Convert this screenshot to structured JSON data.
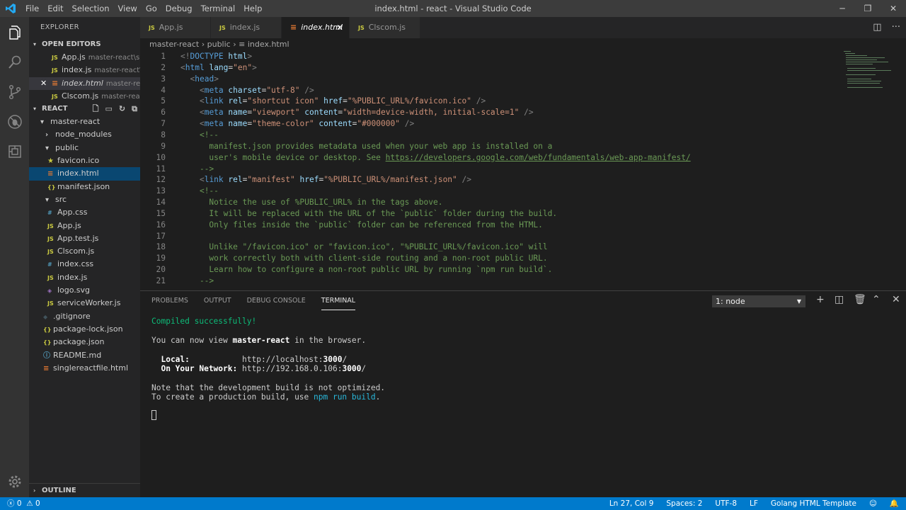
{
  "titlebar": {
    "menu": [
      "File",
      "Edit",
      "Selection",
      "View",
      "Go",
      "Debug",
      "Terminal",
      "Help"
    ],
    "title": "index.html - react - Visual Studio Code"
  },
  "sidebar": {
    "header": "EXPLORER",
    "open_editors_label": "OPEN EDITORS",
    "open_editors": [
      {
        "name": "App.js",
        "path": "master-react\\src"
      },
      {
        "name": "index.js",
        "path": "master-react\\..."
      },
      {
        "name": "index.html",
        "path": "master-rea..."
      },
      {
        "name": "Clscom.js",
        "path": "master-reac..."
      }
    ],
    "react_label": "REACT",
    "tree": [
      {
        "name": "master-react",
        "icon": "▾",
        "kind": "folder",
        "indent": 16
      },
      {
        "name": "node_modules",
        "icon": "›",
        "kind": "folder",
        "indent": 23
      },
      {
        "name": "public",
        "icon": "▾",
        "kind": "folder",
        "indent": 23
      },
      {
        "name": "favicon.ico",
        "icon": "★",
        "kind": "star",
        "indent": 26
      },
      {
        "name": "index.html",
        "icon": "≡",
        "kind": "html",
        "indent": 26
      },
      {
        "name": "manifest.json",
        "icon": "{}",
        "kind": "json",
        "indent": 26
      },
      {
        "name": "src",
        "icon": "▾",
        "kind": "folder",
        "indent": 23
      },
      {
        "name": "App.css",
        "icon": "#",
        "kind": "css",
        "indent": 26
      },
      {
        "name": "App.js",
        "icon": "JS",
        "kind": "js",
        "indent": 26
      },
      {
        "name": "App.test.js",
        "icon": "JS",
        "kind": "js",
        "indent": 26
      },
      {
        "name": "Clscom.js",
        "icon": "JS",
        "kind": "js",
        "indent": 26
      },
      {
        "name": "index.css",
        "icon": "#",
        "kind": "css",
        "indent": 26
      },
      {
        "name": "index.js",
        "icon": "JS",
        "kind": "js",
        "indent": 26
      },
      {
        "name": "logo.svg",
        "icon": "◈",
        "kind": "svg",
        "indent": 26
      },
      {
        "name": "serviceWorker.js",
        "icon": "JS",
        "kind": "js",
        "indent": 26
      },
      {
        "name": ".gitignore",
        "icon": "◆",
        "kind": "git",
        "indent": 20
      },
      {
        "name": "package-lock.json",
        "icon": "{}",
        "kind": "json",
        "indent": 20
      },
      {
        "name": "package.json",
        "icon": "{}",
        "kind": "json",
        "indent": 20
      },
      {
        "name": "README.md",
        "icon": "ⓘ",
        "kind": "md",
        "indent": 20
      },
      {
        "name": "singlereactfile.html",
        "icon": "≡",
        "kind": "html",
        "indent": 20
      }
    ],
    "outline_label": "OUTLINE"
  },
  "tabs": [
    {
      "label": "App.js"
    },
    {
      "label": "index.js"
    },
    {
      "label": "index.html"
    },
    {
      "label": "Clscom.js"
    }
  ],
  "breadcrumb": {
    "parts": [
      "master-react",
      "public",
      "index.html"
    ]
  },
  "editor": {
    "lines": [
      {
        "n": "1",
        "html": "<span class='t-tag'>&lt;!</span><span class='t-el'>DOCTYPE</span> <span class='t-at'>html</span><span class='t-tag'>&gt;</span>"
      },
      {
        "n": "2",
        "html": "<span class='t-tag'>&lt;</span><span class='t-el'>html</span> <span class='t-at'>lang</span>=<span class='t-st'>\"en\"</span><span class='t-tag'>&gt;</span>"
      },
      {
        "n": "3",
        "html": "  <span class='t-tag'>&lt;</span><span class='t-el'>head</span><span class='t-tag'>&gt;</span>"
      },
      {
        "n": "4",
        "html": "    <span class='t-tag'>&lt;</span><span class='t-el'>meta</span> <span class='t-at'>charset</span>=<span class='t-st'>\"utf-8\"</span> <span class='t-tag'>/&gt;</span>"
      },
      {
        "n": "5",
        "html": "    <span class='t-tag'>&lt;</span><span class='t-el'>link</span> <span class='t-at'>rel</span>=<span class='t-st'>\"shortcut icon\"</span> <span class='t-at'>href</span>=<span class='t-st'>\"%PUBLIC_URL%/favicon.ico\"</span> <span class='t-tag'>/&gt;</span>"
      },
      {
        "n": "6",
        "html": "    <span class='t-tag'>&lt;</span><span class='t-el'>meta</span> <span class='t-at'>name</span>=<span class='t-st'>\"viewport\"</span> <span class='t-at'>content</span>=<span class='t-st'>\"width=device-width, initial-scale=1\"</span> <span class='t-tag'>/&gt;</span>"
      },
      {
        "n": "7",
        "html": "    <span class='t-tag'>&lt;</span><span class='t-el'>meta</span> <span class='t-at'>name</span>=<span class='t-st'>\"theme-color\"</span> <span class='t-at'>content</span>=<span class='t-st'>\"#000000\"</span> <span class='t-tag'>/&gt;</span>"
      },
      {
        "n": "8",
        "html": "    <span class='t-cm'>&lt;!--</span>"
      },
      {
        "n": "9",
        "html": "<span class='t-cm'>      manifest.json provides metadata used when your web app is installed on a</span>"
      },
      {
        "n": "10",
        "html": "<span class='t-cm'>      user's mobile device or desktop. See </span><span class='t-url'>https://developers.google.com/web/fundamentals/web-app-manifest/</span>"
      },
      {
        "n": "11",
        "html": "<span class='t-cm'>    --&gt;</span>"
      },
      {
        "n": "12",
        "html": "    <span class='t-tag'>&lt;</span><span class='t-el'>link</span> <span class='t-at'>rel</span>=<span class='t-st'>\"manifest\"</span> <span class='t-at'>href</span>=<span class='t-st'>\"%PUBLIC_URL%/manifest.json\"</span> <span class='t-tag'>/&gt;</span>"
      },
      {
        "n": "13",
        "html": "    <span class='t-cm'>&lt;!--</span>"
      },
      {
        "n": "14",
        "html": "<span class='t-cm'>      Notice the use of %PUBLIC_URL% in the tags above.</span>"
      },
      {
        "n": "15",
        "html": "<span class='t-cm'>      It will be replaced with the URL of the `public` folder during the build.</span>"
      },
      {
        "n": "16",
        "html": "<span class='t-cm'>      Only files inside the `public` folder can be referenced from the HTML.</span>"
      },
      {
        "n": "17",
        "html": ""
      },
      {
        "n": "18",
        "html": "<span class='t-cm'>      Unlike \"/favicon.ico\" or \"favicon.ico\", \"%PUBLIC_URL%/favicon.ico\" will</span>"
      },
      {
        "n": "19",
        "html": "<span class='t-cm'>      work correctly both with client-side routing and a non-root public URL.</span>"
      },
      {
        "n": "20",
        "html": "<span class='t-cm'>      Learn how to configure a non-root public URL by running `npm run build`.</span>"
      },
      {
        "n": "21",
        "html": "<span class='t-cm'>    --&gt;</span>"
      }
    ]
  },
  "panel": {
    "tabs": [
      "PROBLEMS",
      "OUTPUT",
      "DEBUG CONSOLE",
      "TERMINAL"
    ],
    "terminal_select": "1: node",
    "terminal": {
      "compiled": "Compiled successfully!",
      "view_pre": "You can now view ",
      "view_app": "master-react",
      "view_post": " in the browser.",
      "local_label": "  Local:",
      "local_url_pre": "http://localhost:",
      "local_port": "3000",
      "local_url_post": "/",
      "network_label": "  On Your Network:",
      "network_url_pre": "http://192.168.0.106:",
      "network_port": "3000",
      "network_url_post": "/",
      "note": "Note that the development build is not optimized.",
      "prod_pre": "To create a production build, use ",
      "prod_cmd": "npm run build",
      "prod_post": "."
    }
  },
  "statusbar": {
    "errors": "0",
    "warnings": "0",
    "position": "Ln 27, Col 9",
    "spaces": "Spaces: 2",
    "encoding": "UTF-8",
    "eol": "LF",
    "language": "Golang HTML Template"
  }
}
